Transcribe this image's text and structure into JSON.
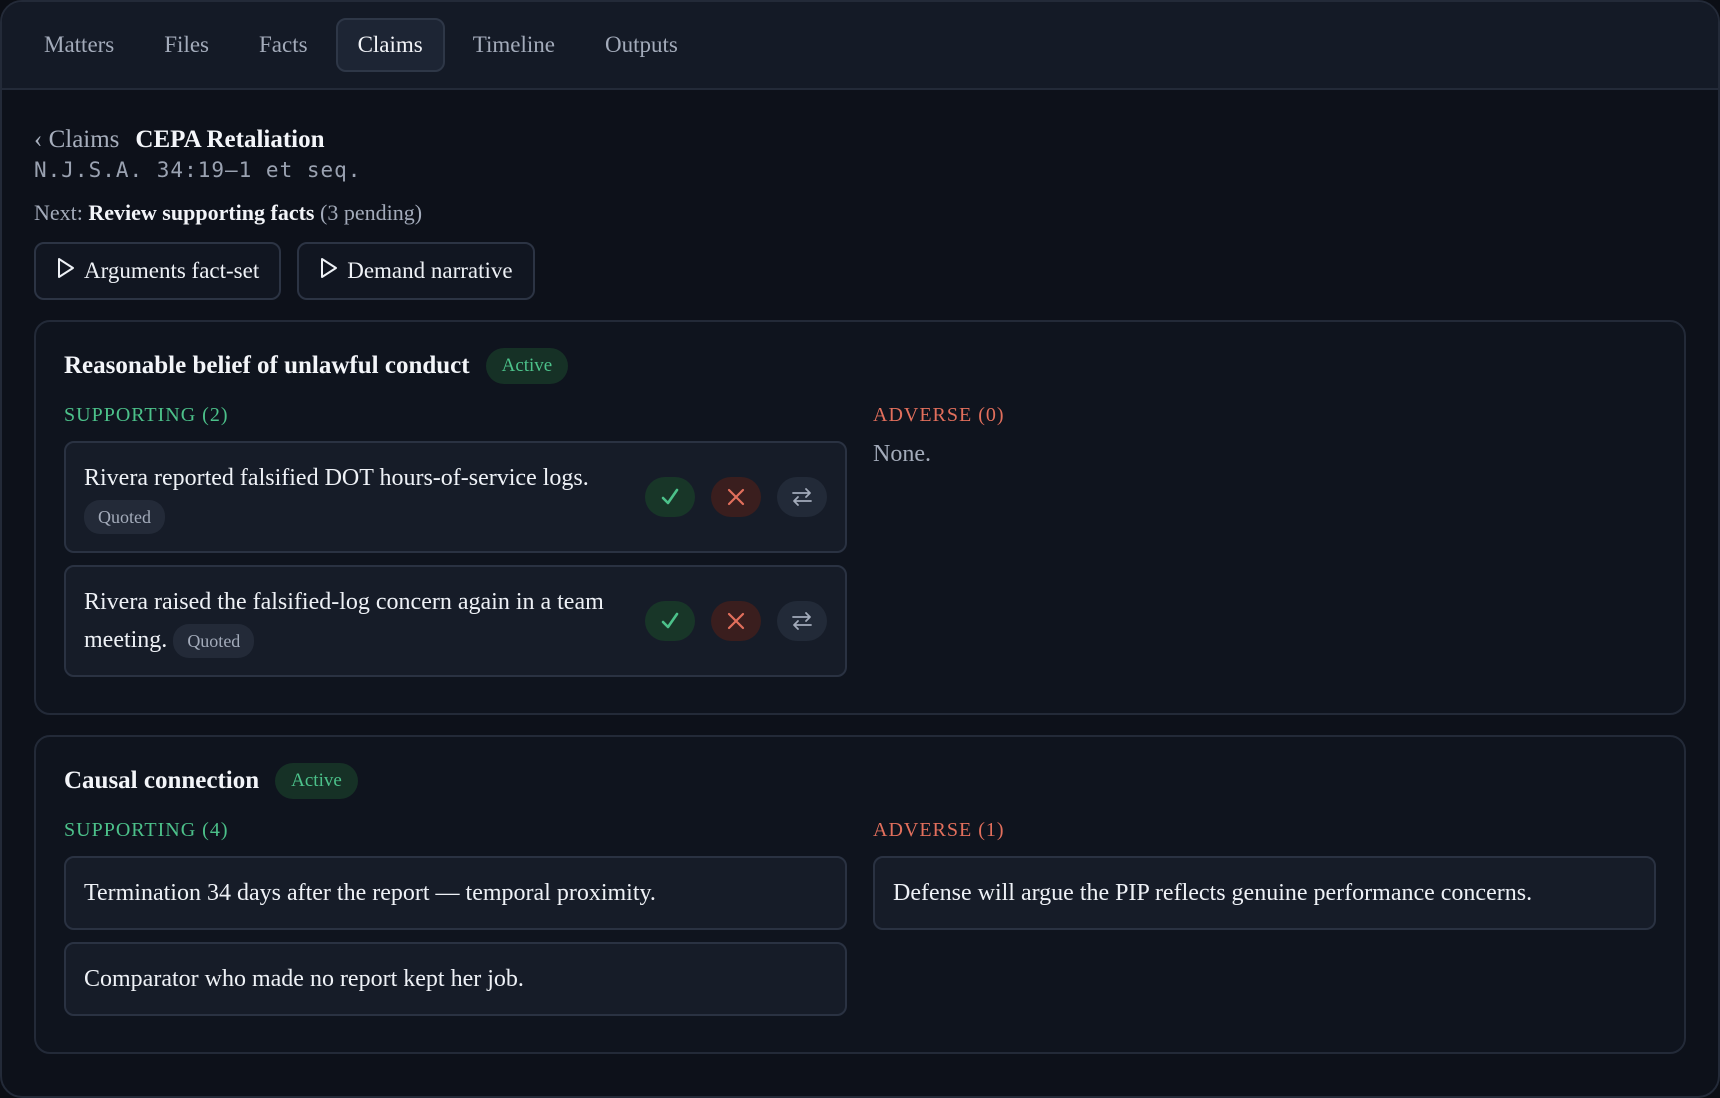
{
  "nav": {
    "tabs": [
      "Matters",
      "Files",
      "Facts",
      "Claims",
      "Timeline",
      "Outputs"
    ],
    "active": "Claims"
  },
  "breadcrumb": {
    "back": "‹ Claims",
    "title": "CEPA Retaliation"
  },
  "statute": "N.J.S.A. 34:19–1 et seq.",
  "next": {
    "prefix": "Next:",
    "action": "Review supporting facts",
    "suffix": "(3 pending)"
  },
  "actions": {
    "arguments": "Arguments fact-set",
    "demand": "Demand narrative"
  },
  "elements": [
    {
      "title": "Reasonable belief of unlawful conduct",
      "status": "Active",
      "supporting_label": "SUPPORTING (2)",
      "adverse_label": "ADVERSE (0)",
      "supporting": [
        {
          "text": "Rivera reported falsified DOT hours-of-service logs.",
          "tag": "Quoted"
        },
        {
          "text": "Rivera raised the falsified-log concern again in a team meeting.",
          "tag": "Quoted"
        }
      ],
      "adverse_empty": "None."
    },
    {
      "title": "Causal connection",
      "status": "Active",
      "supporting_label": "SUPPORTING (4)",
      "adverse_label": "ADVERSE (1)",
      "supporting": [
        {
          "text": "Termination 34 days after the report — temporal proximity."
        },
        {
          "text": "Comparator who made no report kept her job."
        }
      ],
      "adverse": [
        {
          "text": "Defense will argue the PIP reflects genuine performance concerns."
        }
      ]
    }
  ],
  "colors": {
    "supporting": "#4cc18a",
    "adverse": "#e26f5c",
    "background": "#0d111a"
  },
  "icons": {
    "accept": "check-icon",
    "reject": "x-icon",
    "move": "swap-arrows-icon",
    "generate": "play-triangle-icon"
  }
}
